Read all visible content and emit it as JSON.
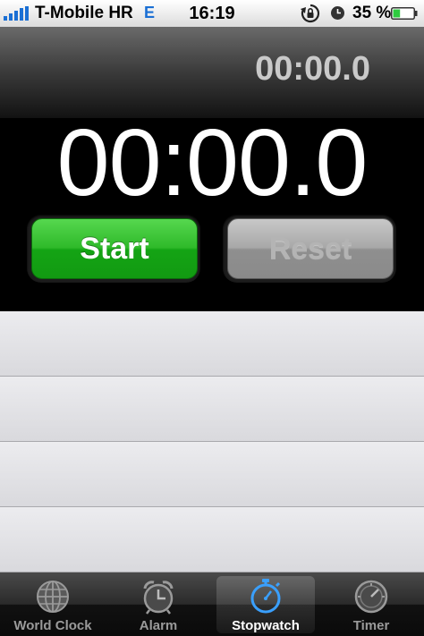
{
  "status_bar": {
    "carrier": "T-Mobile HR",
    "network": "E",
    "time": "16:19",
    "battery_percent": "35 %",
    "battery_level": 0.35,
    "icons": [
      "signal-bars-icon",
      "rotation-lock-icon",
      "alarm-icon",
      "battery-icon"
    ]
  },
  "stopwatch": {
    "lap_time": "00:00.0",
    "main_time": "00:00.0",
    "start_label": "Start",
    "reset_label": "Reset",
    "start_color": "#1fae1f",
    "reset_enabled": false
  },
  "lap_list": {
    "rows": [
      "",
      "",
      "",
      ""
    ]
  },
  "tab_bar": {
    "tabs": [
      {
        "label": "World Clock",
        "icon": "globe-icon",
        "active": false
      },
      {
        "label": "Alarm",
        "icon": "alarm-clock-icon",
        "active": false
      },
      {
        "label": "Stopwatch",
        "icon": "stopwatch-icon",
        "active": true
      },
      {
        "label": "Timer",
        "icon": "timer-icon",
        "active": false
      }
    ],
    "active_color": "#3aa0ff"
  }
}
